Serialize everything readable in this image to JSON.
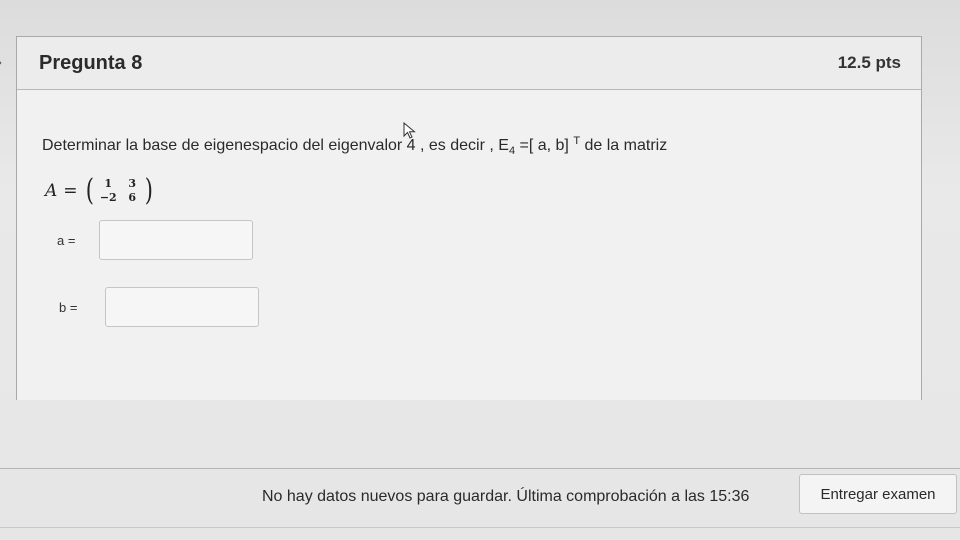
{
  "question": {
    "title": "Pregunta 8",
    "points": "12.5 pts",
    "prompt": {
      "part1": "Determinar  la base de eigenespacio del  eigenvalor  4 , es decir , E",
      "subscript": "4",
      "part2": " =[ a,  b] ",
      "superscript": "T",
      "part3": " de la matriz"
    },
    "matrix": {
      "variable": "A",
      "equals": "=",
      "cells": [
        "1",
        "3",
        "−2",
        "6"
      ]
    },
    "answers": [
      {
        "label": "a  =",
        "value": ""
      },
      {
        "label": "b  =",
        "value": ""
      }
    ]
  },
  "footer": {
    "status": "No hay datos nuevos para guardar. Última comprobación a las 15:36",
    "submit_label": "Entregar examen"
  }
}
